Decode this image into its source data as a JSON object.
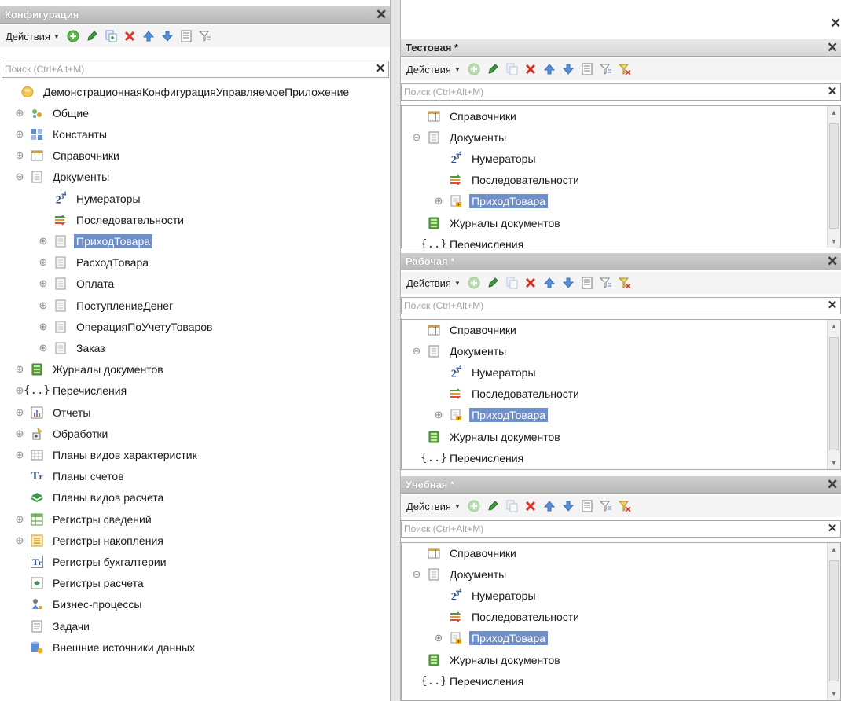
{
  "left": {
    "title": "Конфигурация",
    "actions_label": "Действия",
    "search_placeholder": "Поиск (Ctrl+Alt+M)",
    "tree": [
      {
        "label": "ДемонстрационнаяКонфигурацияУправляемоеПриложение",
        "icon": "config-root-icon",
        "expander": ""
      },
      {
        "label": "Общие",
        "icon": "common-icon",
        "expander": "plus"
      },
      {
        "label": "Константы",
        "icon": "constants-icon",
        "expander": "plus"
      },
      {
        "label": "Справочники",
        "icon": "catalogs-icon",
        "expander": "plus"
      },
      {
        "label": "Документы",
        "icon": "documents-icon",
        "expander": "minus"
      },
      {
        "label": "Нумераторы",
        "icon": "numerators-icon",
        "expander": "",
        "indent": 1
      },
      {
        "label": "Последовательности",
        "icon": "sequences-icon",
        "expander": "",
        "indent": 1
      },
      {
        "label": "ПриходТовара",
        "icon": "document-icon",
        "expander": "plus",
        "indent": 1,
        "selected": true
      },
      {
        "label": "РасходТовара",
        "icon": "document-icon",
        "expander": "plus",
        "indent": 1
      },
      {
        "label": "Оплата",
        "icon": "document-icon",
        "expander": "plus",
        "indent": 1
      },
      {
        "label": "ПоступлениеДенег",
        "icon": "document-icon",
        "expander": "plus",
        "indent": 1
      },
      {
        "label": "ОперацияПоУчетуТоваров",
        "icon": "document-icon",
        "expander": "plus",
        "indent": 1
      },
      {
        "label": "Заказ",
        "icon": "document-icon",
        "expander": "plus",
        "indent": 1
      },
      {
        "label": "Журналы документов",
        "icon": "journals-icon",
        "expander": "plus"
      },
      {
        "label": "Перечисления",
        "icon": "enums-icon",
        "expander": "plus"
      },
      {
        "label": "Отчеты",
        "icon": "reports-icon",
        "expander": "plus"
      },
      {
        "label": "Обработки",
        "icon": "dataprocessors-icon",
        "expander": "plus"
      },
      {
        "label": "Планы видов характеристик",
        "icon": "chart-of-characteristics-icon",
        "expander": "plus"
      },
      {
        "label": "Планы счетов",
        "icon": "chart-of-accounts-icon",
        "expander": ""
      },
      {
        "label": "Планы видов расчета",
        "icon": "chart-of-calc-icon",
        "expander": ""
      },
      {
        "label": "Регистры сведений",
        "icon": "info-registers-icon",
        "expander": "plus"
      },
      {
        "label": "Регистры накопления",
        "icon": "accum-registers-icon",
        "expander": "plus"
      },
      {
        "label": "Регистры бухгалтерии",
        "icon": "accounting-registers-icon",
        "expander": ""
      },
      {
        "label": "Регистры расчета",
        "icon": "calc-registers-icon",
        "expander": ""
      },
      {
        "label": "Бизнес-процессы",
        "icon": "business-processes-icon",
        "expander": ""
      },
      {
        "label": "Задачи",
        "icon": "tasks-icon",
        "expander": ""
      },
      {
        "label": "Внешние источники данных",
        "icon": "external-sources-icon",
        "expander": ""
      }
    ]
  },
  "panels": [
    {
      "title": "Тестовая *",
      "active": true,
      "actions_label": "Действия",
      "search_placeholder": "Поиск (Ctrl+Alt+M)",
      "tree": [
        {
          "label": "Справочники",
          "icon": "catalogs-icon",
          "expander": ""
        },
        {
          "label": "Документы",
          "icon": "documents-icon",
          "expander": "minus"
        },
        {
          "label": "Нумераторы",
          "icon": "numerators-icon",
          "expander": "",
          "indent": 1
        },
        {
          "label": "Последовательности",
          "icon": "sequences-icon",
          "expander": "",
          "indent": 1
        },
        {
          "label": "ПриходТовара",
          "icon": "document-plus-icon",
          "expander": "plus",
          "indent": 1,
          "selected": true
        },
        {
          "label": "Журналы документов",
          "icon": "journals-icon",
          "expander": ""
        },
        {
          "label": "Перечисления",
          "icon": "enums-icon",
          "expander": ""
        }
      ]
    },
    {
      "title": "Рабочая *",
      "active": false,
      "actions_label": "Действия",
      "search_placeholder": "Поиск (Ctrl+Alt+M)",
      "tree": [
        {
          "label": "Справочники",
          "icon": "catalogs-icon",
          "expander": ""
        },
        {
          "label": "Документы",
          "icon": "documents-icon",
          "expander": "minus"
        },
        {
          "label": "Нумераторы",
          "icon": "numerators-icon",
          "expander": "",
          "indent": 1
        },
        {
          "label": "Последовательности",
          "icon": "sequences-icon",
          "expander": "",
          "indent": 1
        },
        {
          "label": "ПриходТовара",
          "icon": "document-plus-icon",
          "expander": "plus",
          "indent": 1,
          "selected": true
        },
        {
          "label": "Журналы документов",
          "icon": "journals-icon",
          "expander": ""
        },
        {
          "label": "Перечисления",
          "icon": "enums-icon",
          "expander": ""
        }
      ]
    },
    {
      "title": "Учебная *",
      "active": false,
      "actions_label": "Действия",
      "search_placeholder": "Поиск (Ctrl+Alt+M)",
      "tree": [
        {
          "label": "Справочники",
          "icon": "catalogs-icon",
          "expander": ""
        },
        {
          "label": "Документы",
          "icon": "documents-icon",
          "expander": "minus"
        },
        {
          "label": "Нумераторы",
          "icon": "numerators-icon",
          "expander": "",
          "indent": 1
        },
        {
          "label": "Последовательности",
          "icon": "sequences-icon",
          "expander": "",
          "indent": 1
        },
        {
          "label": "ПриходТовара",
          "icon": "document-plus-icon",
          "expander": "plus",
          "indent": 1,
          "selected": true
        },
        {
          "label": "Журналы документов",
          "icon": "journals-icon",
          "expander": ""
        },
        {
          "label": "Перечисления",
          "icon": "enums-icon",
          "expander": ""
        }
      ]
    }
  ],
  "toolbar_icons": [
    "add-icon",
    "edit-icon",
    "copy-icon",
    "delete-icon",
    "move-up-icon",
    "move-down-icon",
    "list-icon",
    "filter-icon",
    "filter-clear-icon"
  ],
  "colors": {
    "selection": "#6f8fc9",
    "titlebar_inactive": "#b9b9b9",
    "titlebar_active": "#dedede"
  }
}
